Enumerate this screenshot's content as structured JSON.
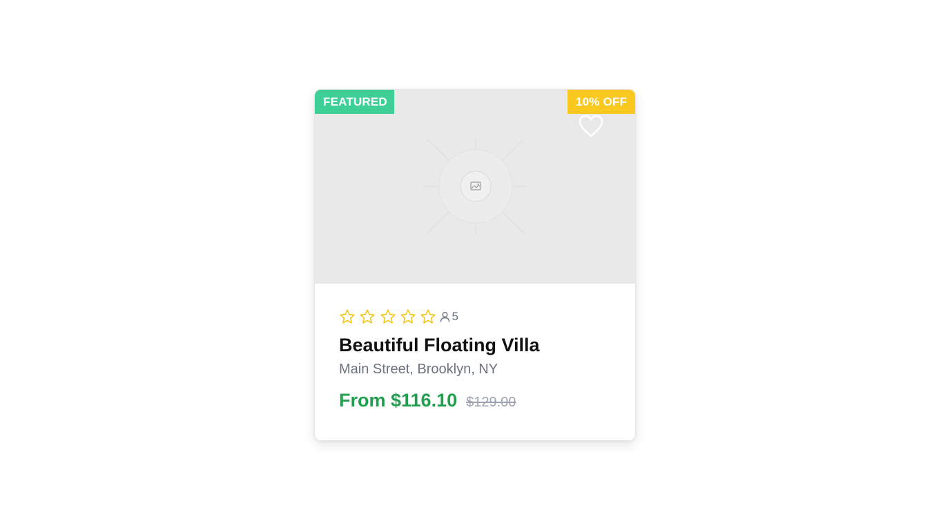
{
  "listing": {
    "badges": {
      "featured": "FEATURED",
      "discount": "10% OFF"
    },
    "image": {
      "icon": "image-placeholder-icon"
    },
    "favorite": {
      "icon": "heart-icon",
      "saved": false
    },
    "rating": {
      "stars": 5,
      "filled": 0,
      "icon": "star-icon"
    },
    "guests": {
      "icon": "user-icon",
      "count": "5"
    },
    "title": "Beautiful Floating Villa",
    "address": "Main Street, Brooklyn, NY",
    "price": {
      "current": "From $116.10",
      "original": "$129.00"
    }
  },
  "colors": {
    "featured_badge": "#3ecf96",
    "discount_badge": "#f9c91f",
    "star": "#f5c518",
    "price": "#20a04f",
    "image_background": "#e9e9e9"
  }
}
